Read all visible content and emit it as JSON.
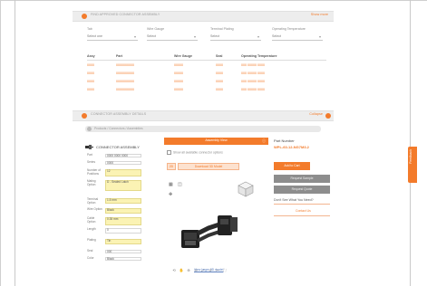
{
  "top_section": {
    "title": "FIND APPROVED CONNECTOR ASSEMBLY",
    "action": "Show more",
    "filters": [
      {
        "label": "Tab",
        "value": "Select one"
      },
      {
        "label": "Wire Gauge",
        "value": "Select"
      },
      {
        "label": "Terminal Plating",
        "value": "Select"
      },
      {
        "label": "Operating Temperature",
        "value": "Select"
      }
    ],
    "columns": [
      "Assy",
      "Part",
      "Wire Gauge",
      "Seal",
      "Operating Temperature"
    ],
    "rows": [
      [
        "0000",
        "0000000000",
        "00000",
        "0000",
        "000 00000 0000"
      ],
      [
        "0000",
        "0000000000",
        "00000",
        "0000",
        "000 00000 0000"
      ],
      [
        "0000",
        "0000000000",
        "00000",
        "0000",
        "000 00000 0000"
      ],
      [
        "0000",
        "0000000000",
        "00000",
        "0000",
        "000 00000 0000"
      ]
    ]
  },
  "lower_section": {
    "title": "CONNECTOR ASSEMBLY DETAILS",
    "action": "Collapse",
    "breadcrumb": "Products / Connectors / Assemblies"
  },
  "product": {
    "title": "CONNECTOR ASSEMBLY",
    "properties": [
      {
        "label": "Part",
        "value": "0000 0000 0000",
        "highlight": false
      },
      {
        "label": "Series",
        "value": "0000",
        "highlight": false
      },
      {
        "label": "Number of Positions",
        "value": "12",
        "highlight": true
      },
      {
        "label": "Mating Option",
        "value": "D - Sealed Latch",
        "highlight": true
      },
      {
        "label": "Terminal Option",
        "value": "1.5 mm",
        "highlight": true
      },
      {
        "label": "Wire Option",
        "value": "Black",
        "highlight": true
      },
      {
        "label": "Cable Option",
        "value": "0.35 mm",
        "highlight": true
      },
      {
        "label": "Length",
        "value": "0",
        "highlight": false
      },
      {
        "label": "Plating",
        "value": "Tin",
        "highlight": true
      },
      {
        "label": "Seal",
        "value": "000",
        "highlight": false
      },
      {
        "label": "Color",
        "value": "Black",
        "highlight": false
      }
    ]
  },
  "viewer": {
    "header": "Assembly View",
    "header_icon": "info-icon",
    "option_text": "Show all available connector options",
    "button_small": "2D",
    "button_wide": "Download 3D Model",
    "link": "View larger 3D model",
    "tools": [
      "rotate-icon",
      "pan-icon",
      "zoom-in-icon",
      "zoom-out-icon",
      "fit-icon",
      "reset-icon",
      "measure-icon",
      "fullscreen-icon"
    ]
  },
  "right_panel": {
    "part_number_label": "Part Number",
    "part_number_value": "WPL-60-12-NG7M3.2",
    "primary_button": "Add to Cart",
    "secondary_buttons": [
      "Request Sample",
      "Request Quote"
    ],
    "question": "Don't See What You Need?",
    "link": "Contact Us"
  },
  "feedback_tab": "Feedback",
  "colors": {
    "accent": "#f37b2b",
    "highlight": "#fbf3b4",
    "button_gray": "#8d8d8d"
  }
}
